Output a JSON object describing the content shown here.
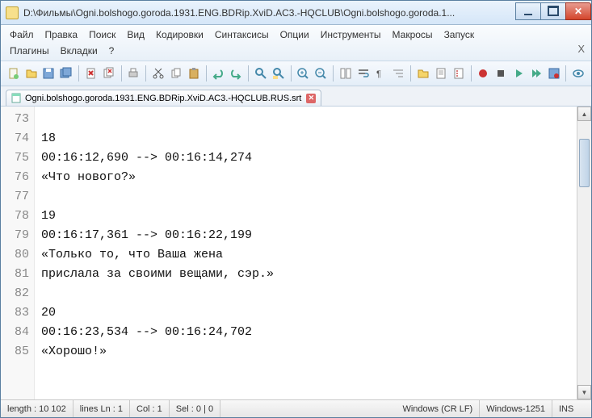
{
  "window": {
    "title": "D:\\Фильмы\\Ogni.bolshogo.goroda.1931.ENG.BDRip.XviD.AC3.-HQCLUB\\Ogni.bolshogo.goroda.1..."
  },
  "menu": {
    "items": [
      "Файл",
      "Правка",
      "Поиск",
      "Вид",
      "Кодировки",
      "Синтаксисы",
      "Опции",
      "Инструменты",
      "Макросы",
      "Запуск",
      "Плагины",
      "Вкладки",
      "?"
    ]
  },
  "tab": {
    "filename": "Ogni.bolshogo.goroda.1931.ENG.BDRip.XviD.AC3.-HQCLUB.RUS.srt"
  },
  "editor": {
    "first_line_number": 73,
    "lines": [
      "",
      "18",
      "00:16:12,690 --> 00:16:14,274",
      "«Что нового?»",
      "",
      "19",
      "00:16:17,361 --> 00:16:22,199",
      "«Только то, что Ваша жена",
      "прислала за своими вещами, сэр.»",
      "",
      "20",
      "00:16:23,534 --> 00:16:24,702",
      "«Хорошо!»"
    ]
  },
  "status": {
    "length": "length : 10 102",
    "lines": "lines   Ln : 1",
    "col": "Col : 1",
    "sel": "Sel : 0 | 0",
    "eol": "Windows (CR LF)",
    "encoding": "Windows-1251",
    "mode": "INS"
  }
}
